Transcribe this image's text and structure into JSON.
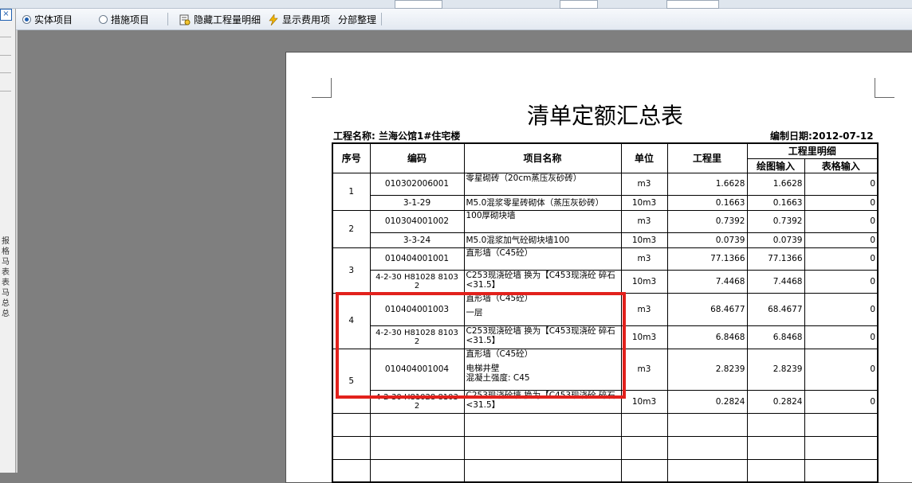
{
  "toolbar": {
    "opt_entity": "实体项目",
    "opt_measure": "措施项目",
    "hide_details": "隐藏工程量明细",
    "show_fees": "显示费用项",
    "arrange": "分部整理"
  },
  "sidebar": {
    "close_label": "×",
    "vertical_text": "报 格 马 表 表 马 总 总"
  },
  "report": {
    "title": "清单定额汇总表",
    "project": "工程名称: 兰海公馆1#住宅楼",
    "date": "编制日期:2012-07-12",
    "headers": {
      "seq": "序号",
      "code": "编码",
      "name": "项目名称",
      "unit": "单位",
      "qty": "工程里",
      "detail": "工程里明细",
      "draw": "绘图输入",
      "table": "表格输入"
    },
    "rows": [
      {
        "seq": "1",
        "code": "010302006001",
        "name": "零星砌砖（20cm蒸压灰砂砖）",
        "unit": "m3",
        "qty": "1.6628",
        "draw": "1.6628",
        "table": "0"
      },
      {
        "code": "3-1-29",
        "name": "M5.0混浆零星砖砌体（蒸压灰砂砖）",
        "unit": "10m3",
        "qty": "0.1663",
        "draw": "0.1663",
        "table": "0"
      },
      {
        "seq": "2",
        "code": "010304001002",
        "name": "100厚砌块墙",
        "unit": "m3",
        "qty": "0.7392",
        "draw": "0.7392",
        "table": "0"
      },
      {
        "code": "3-3-24",
        "name": "M5.0混浆加气砼砌块墙100",
        "unit": "10m3",
        "qty": "0.0739",
        "draw": "0.0739",
        "table": "0"
      },
      {
        "seq": "3",
        "code": "010404001001",
        "name": "直形墙（C45砼）",
        "unit": "m3",
        "qty": "77.1366",
        "draw": "77.1366",
        "table": "0"
      },
      {
        "code": "4-2-30 H81028 8103 2",
        "name": "C253现浇砼墙 换为【C453现浇砼 碎石<31.5】",
        "unit": "10m3",
        "qty": "7.4468",
        "draw": "7.4468",
        "table": "0"
      },
      {
        "seq": "4",
        "code": "010404001003",
        "name": "直形墙（C45砼）",
        "name2": "一层",
        "unit": "m3",
        "qty": "68.4677",
        "draw": "68.4677",
        "table": "0"
      },
      {
        "code": "4-2-30 H81028 8103 2",
        "name": "C253现浇砼墙 换为【C453现浇砼 碎石<31.5】",
        "unit": "10m3",
        "qty": "6.8468",
        "draw": "6.8468",
        "table": "0"
      },
      {
        "seq": "5",
        "code": "010404001004",
        "name": "直形墙（C45砼）",
        "name2": "电梯井壁",
        "name3": "混凝土强度: C45",
        "unit": "m3",
        "qty": "2.8239",
        "draw": "2.8239",
        "table": "0"
      },
      {
        "code": "4-2-30 H81028 8103 2",
        "name": "C253现浇砼墙 换为【C453现浇砼 碎石<31.5】",
        "unit": "10m3",
        "qty": "0.2824",
        "draw": "0.2824",
        "table": "0"
      }
    ]
  },
  "colors": {
    "highlight": "#e2211c",
    "workspace": "#7f7f7f"
  }
}
